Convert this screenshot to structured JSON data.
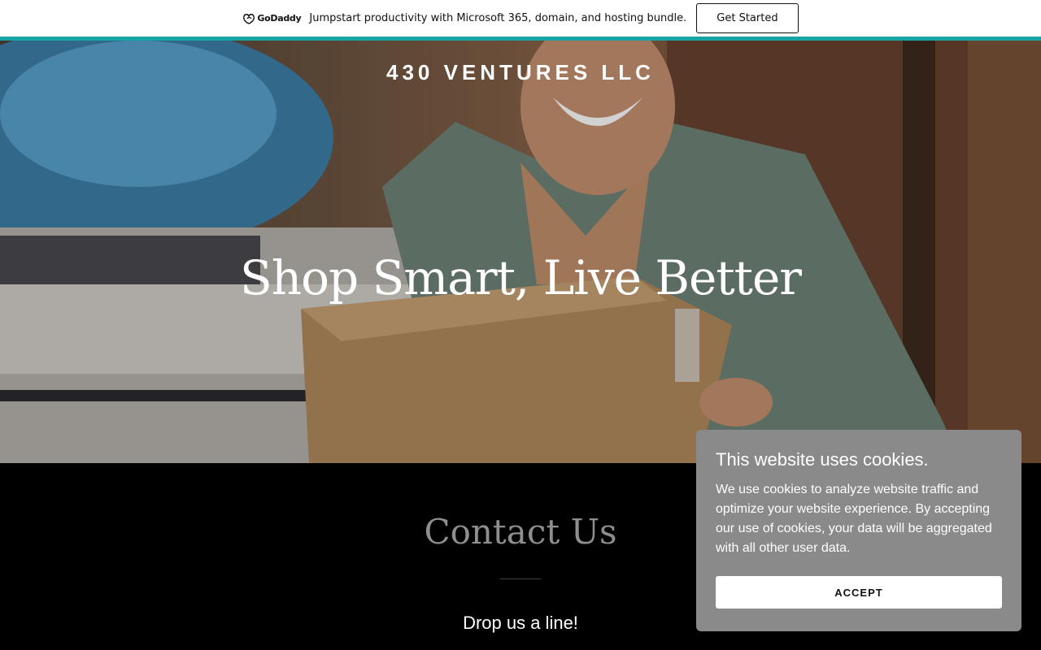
{
  "promo": {
    "logo_text": "GoDaddy",
    "message": "Jumpstart productivity with Microsoft 365, domain, and hosting bundle.",
    "cta_label": "Get Started"
  },
  "hero": {
    "brand": "430 VENTURES LLC",
    "title": "Shop Smart, Live Better"
  },
  "contact": {
    "title": "Contact Us",
    "subtitle": "Drop us a line!"
  },
  "cookie_banner": {
    "title": "This website uses cookies.",
    "body": "We use cookies to analyze website traffic and optimize your website experience. By accepting our use of cookies, your data will be aggregated with all other user data.",
    "accept_label": "ACCEPT"
  },
  "colors": {
    "promo_accent": "#16a5a3",
    "cookie_bg": "#8a8a8a",
    "contact_title": "#8e8e8e"
  }
}
